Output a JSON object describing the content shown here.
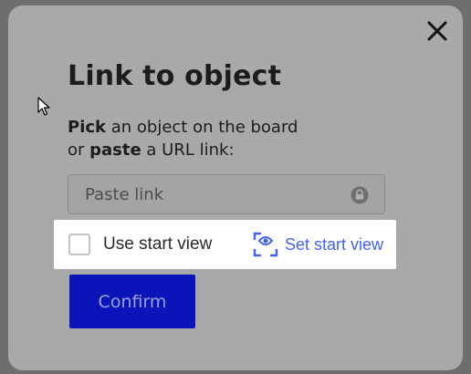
{
  "dialog": {
    "title": "Link to object",
    "instructions": {
      "line1_bold": "Pick",
      "line1_rest": " an object on the board",
      "line2_pre": "or ",
      "line2_bold": "paste",
      "line2_rest": " a URL link:"
    },
    "link_input": {
      "value": "",
      "placeholder": "Paste link"
    },
    "start_view": {
      "checkbox_label": "Use start view",
      "checked": false,
      "set_label": "Set start view"
    },
    "confirm_label": "Confirm"
  },
  "icons": {
    "close": "close-icon",
    "lock": "lock-icon",
    "view_focus": "focus-eye-icon",
    "cursor": "mouse-cursor"
  },
  "colors": {
    "overlay": "#6e6e6e",
    "dialog_bg": "#a9a9a9",
    "accent": "#4262ff",
    "confirm_bg": "#0a14b8",
    "confirm_text": "#9aa0d8"
  }
}
